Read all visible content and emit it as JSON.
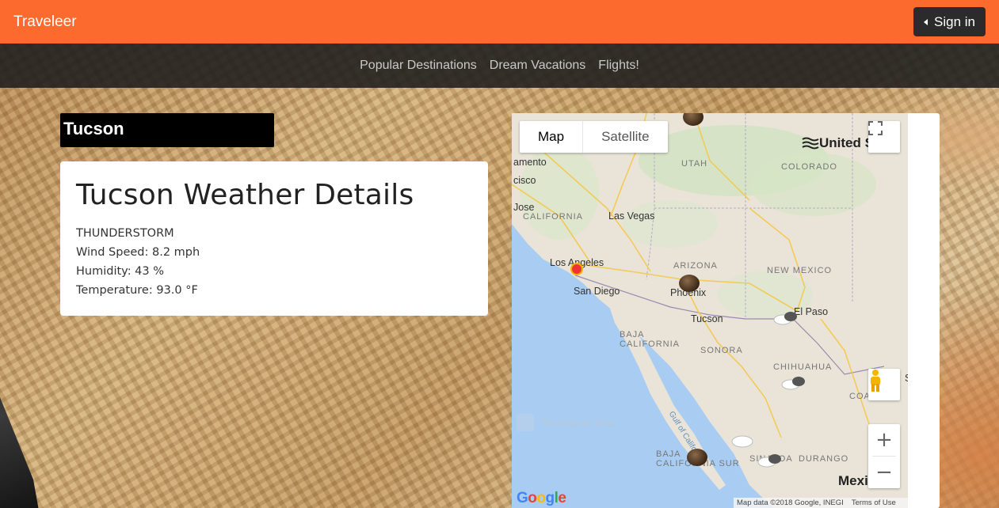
{
  "header": {
    "brand": "Traveleer",
    "signin_label": "Sign in",
    "brand_color": "#fd6a2e"
  },
  "nav": {
    "items": [
      {
        "label": "Popular Destinations"
      },
      {
        "label": "Dream Vacations"
      },
      {
        "label": "Flights!"
      }
    ]
  },
  "city": {
    "name": "Tucson"
  },
  "weather": {
    "title": "Tucson Weather Details",
    "condition": "THUNDERSTORM",
    "wind": "Wind Speed: 8.2 mph",
    "humidity": "Humidity: 43 %",
    "temperature": "Temperature: 93.0 °F"
  },
  "map": {
    "type_map": "Map",
    "type_satellite": "Satellite",
    "zoom_in": "+",
    "zoom_out": "−",
    "footer_data": "Map data ©2018 Google, INEGI",
    "footer_terms": "Terms of Use",
    "snip_text": "Rectangular Snip",
    "labels": {
      "utah": "UTAH",
      "colorado": "COLORADO",
      "california": "CALIFORNIA",
      "arizona": "ARIZONA",
      "new_mexico": "NEW MEXICO",
      "baja_california": "BAJA CALIFORNIA",
      "sonora": "SONORA",
      "chihuahua": "CHIHUAHUA",
      "baja_california_sur": "BAJA CALIFORNIA SUR",
      "sinaloa": "SINALOA",
      "durango": "DURANGO",
      "coa": "COA",
      "united_states": "United Sta",
      "mexico": "Mexi",
      "las_vegas": "Las Vegas",
      "los_angeles": "Los Angeles",
      "san_diego": "San Diego",
      "phoenix": "Phoenix",
      "tucson": "Tucson",
      "el_paso": "El Paso",
      "sacramento": "amento",
      "francisco": "cisco",
      "jose": "Jose",
      "gulf": "Gulf of California",
      "s": "S"
    }
  }
}
